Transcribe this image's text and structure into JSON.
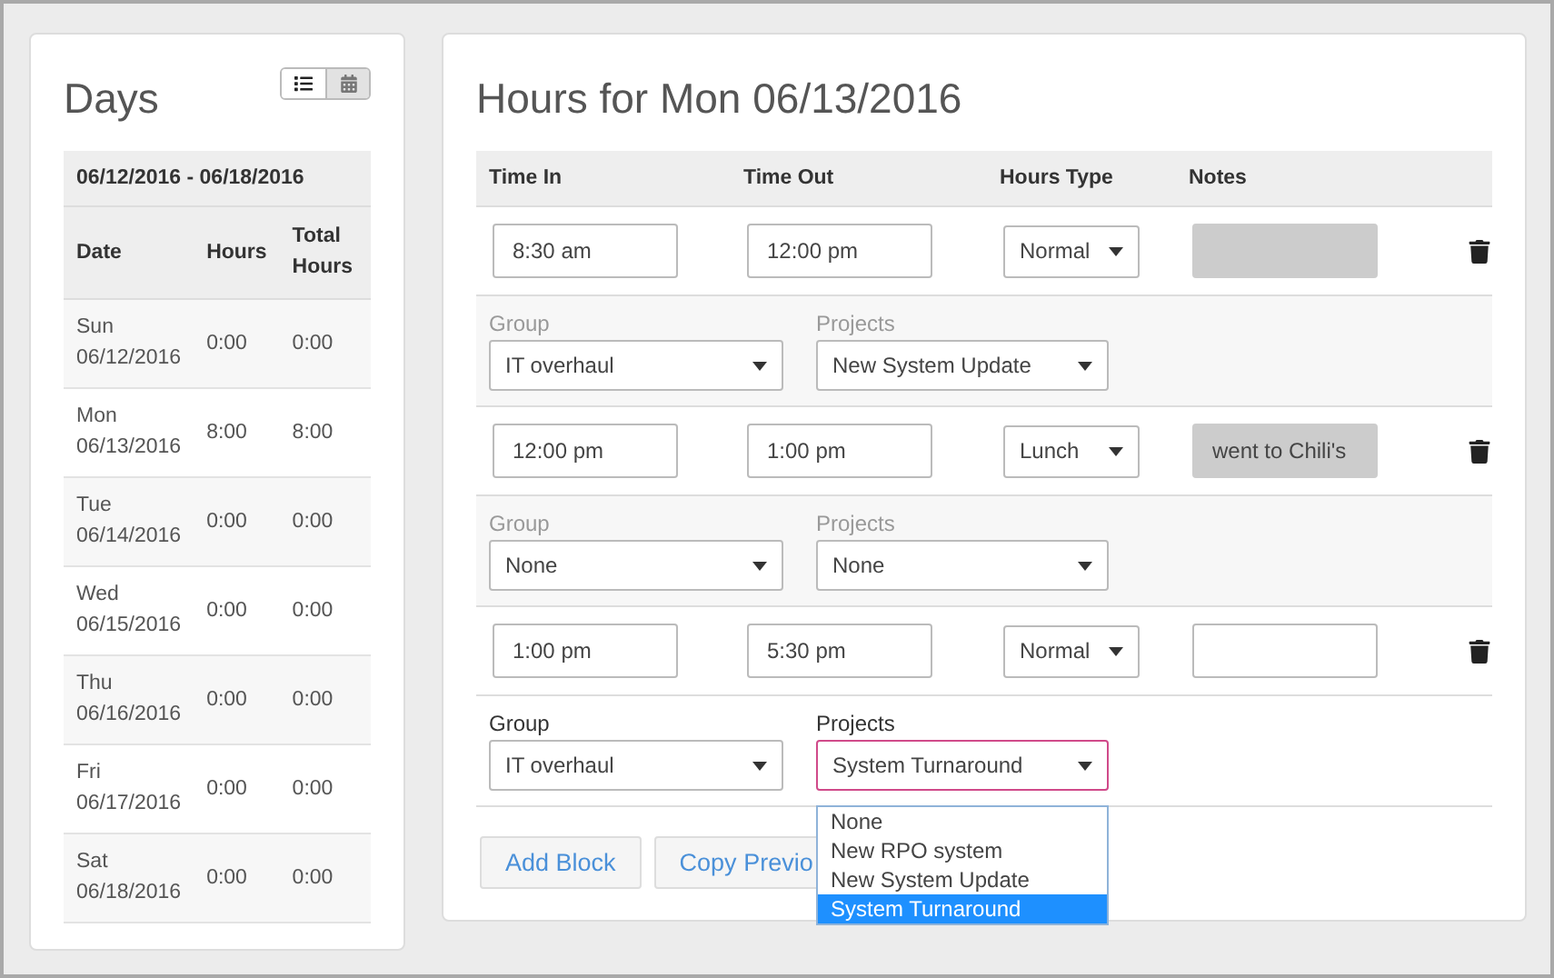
{
  "days_panel": {
    "title": "Days",
    "view_toggle": [
      {
        "kind": "list",
        "selected": true
      },
      {
        "kind": "calendar",
        "selected": false
      }
    ],
    "table": {
      "range": "06/12/2016 - 06/18/2016",
      "columns": [
        "Date",
        "Hours",
        "Total Hours"
      ],
      "rows": [
        {
          "day": "Sun",
          "date": "06/12/2016",
          "hours": "0:00",
          "total": "0:00"
        },
        {
          "day": "Mon",
          "date": "06/13/2016",
          "hours": "8:00",
          "total": "8:00"
        },
        {
          "day": "Tue",
          "date": "06/14/2016",
          "hours": "0:00",
          "total": "0:00"
        },
        {
          "day": "Wed",
          "date": "06/15/2016",
          "hours": "0:00",
          "total": "0:00"
        },
        {
          "day": "Thu",
          "date": "06/16/2016",
          "hours": "0:00",
          "total": "0:00"
        },
        {
          "day": "Fri",
          "date": "06/17/2016",
          "hours": "0:00",
          "total": "0:00"
        },
        {
          "day": "Sat",
          "date": "06/18/2016",
          "hours": "0:00",
          "total": "0:00"
        }
      ]
    }
  },
  "hours_panel": {
    "title": "Hours for Mon 06/13/2016",
    "columns": [
      "Time In",
      "Time Out",
      "Hours Type",
      "Notes"
    ],
    "blocks": [
      {
        "time_in": "8:30 am",
        "time_out": "12:00 pm",
        "hours_type": "Normal",
        "disabled": true,
        "group_label": "Group",
        "group": "IT overhaul",
        "projects_label": "Projects",
        "project": "New System Update",
        "open": false
      },
      {
        "time_in": "12:00 pm",
        "time_out": "1:00 pm",
        "hours_type": "Lunch",
        "notes": "went to Chili's",
        "disabled": true,
        "group_label": "Group",
        "group": "None",
        "projects_label": "Projects",
        "project": "None",
        "open": false
      },
      {
        "time_in": "1:00 pm",
        "time_out": "5:30 pm",
        "hours_type": "Normal",
        "disabled": false,
        "group_label": "Group",
        "group": "IT overhaul",
        "projects_label": "Projects",
        "project": "System Turnaround",
        "open": true,
        "options": [
          {
            "label": "None",
            "selected": false
          },
          {
            "label": "New RPO system",
            "selected": false
          },
          {
            "label": "New System Update",
            "selected": false
          },
          {
            "label": "System Turnaround",
            "selected": true
          }
        ]
      }
    ],
    "buttons": [
      "Add Block",
      "Copy Previo"
    ]
  }
}
